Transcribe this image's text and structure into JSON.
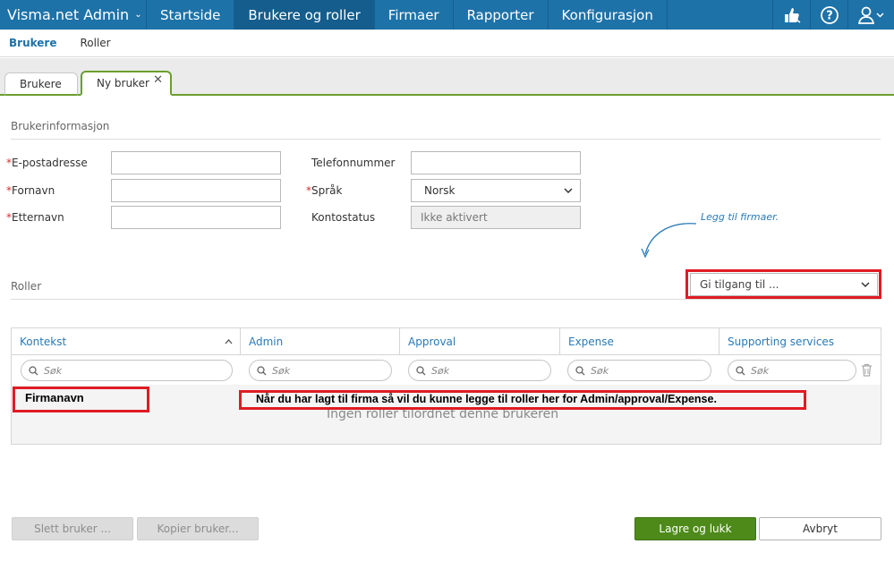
{
  "topnav": {
    "brand": "Visma.net Admin",
    "items": [
      "Startside",
      "Brukere og roller",
      "Firmaer",
      "Rapporter",
      "Konfigurasjon"
    ],
    "active_index": 1,
    "icons": [
      "thumbs-up-icon",
      "help-icon",
      "user-icon"
    ]
  },
  "subnav": {
    "items": [
      "Brukere",
      "Roller"
    ],
    "active_index": 0
  },
  "tabs": [
    {
      "label": "Brukere"
    },
    {
      "label": "Ny bruker",
      "close": "✕"
    }
  ],
  "userinfo": {
    "title": "Brukerinformasjon",
    "email_label": "E-postadresse",
    "firstname_label": "Fornavn",
    "lastname_label": "Etternavn",
    "phone_label": "Telefonnummer",
    "language_label": "Språk",
    "language_value": "Norsk",
    "status_label": "Kontostatus",
    "status_value": "Ikke aktivert",
    "required_mark": "*"
  },
  "roles": {
    "title": "Roller",
    "hint": "Legg til firmaer.",
    "grant_access_placeholder": "Gi tilgang til ...",
    "columns": [
      "Kontekst",
      "Admin",
      "Approval",
      "Expense",
      "Supporting services"
    ],
    "search_placeholder": "Søk",
    "empty_message": "Ingen roller tilordnet denne brukeren"
  },
  "annotations": {
    "company_name": "Firmanavn",
    "note": "Når du har lagt til firma så vil du kunne legge til roller her for Admin/approval/Expense."
  },
  "buttons": {
    "delete_user": "Slett bruker ...",
    "copy_user": "Kopier bruker...",
    "save_close": "Lagre og lukk",
    "cancel": "Avbryt"
  },
  "colors": {
    "nav": "#1d72a8",
    "accent_green": "#4d8a1a",
    "annotation_red": "#e01b24"
  }
}
